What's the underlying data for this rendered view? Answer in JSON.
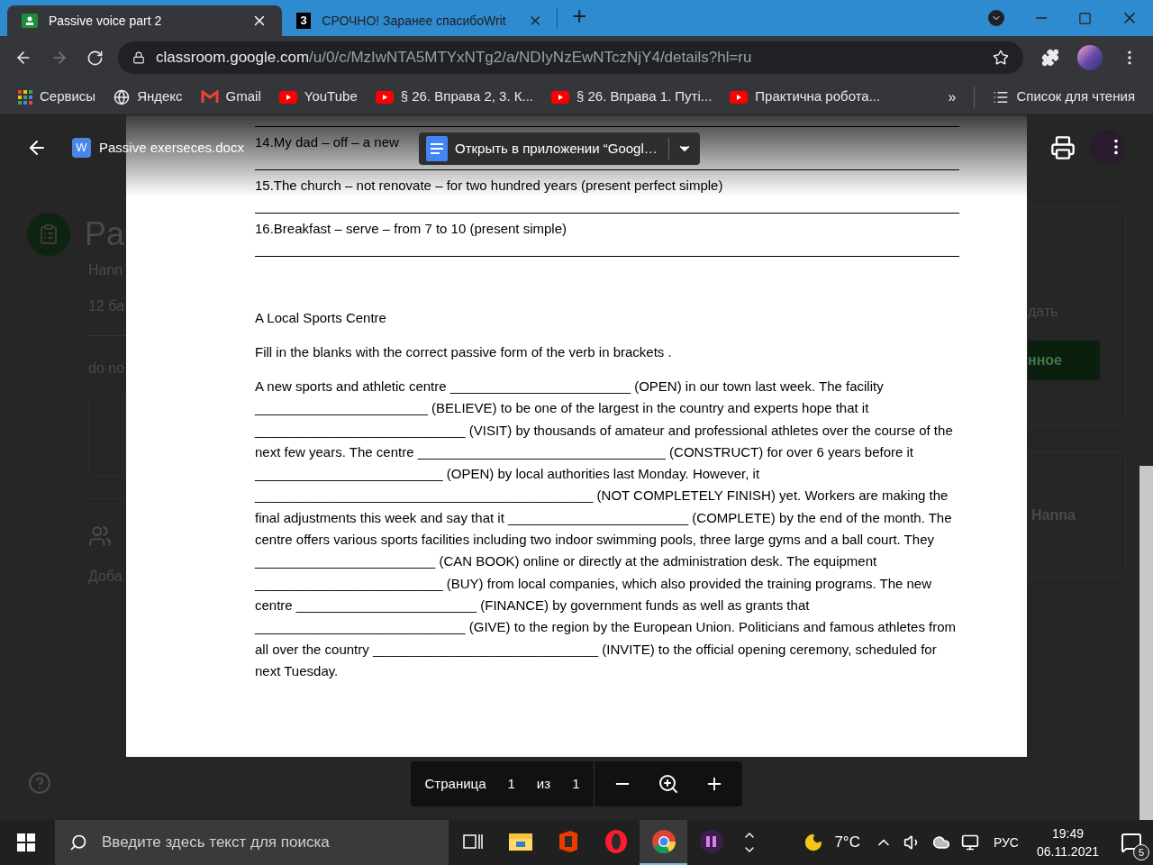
{
  "browser": {
    "tabs": [
      {
        "title": "Passive voice part 2",
        "selected": true
      },
      {
        "title": "СРОЧНО! Заранее спасибоWrit",
        "favicon_text": "3",
        "selected": false
      }
    ],
    "new_tab": "+",
    "forward_disabled": true,
    "url_host": "classroom.google.com",
    "url_path": "/u/0/c/MzIwNTA5MTYxNTg2/a/NDIyNzEwNTczNjY4/details?hl=ru",
    "bookmarks": [
      "Сервисы",
      "Яндекс",
      "Gmail",
      "YouTube",
      "§ 26. Вправа 2, 3. К...",
      "§ 26. Вправа 1. Путі...",
      "Практична робота..."
    ],
    "overflow": "»",
    "reading_list": "Список для чтения"
  },
  "background": {
    "left": {
      "title": "Pa",
      "author": "Hann",
      "points": "12 ба",
      "note": "do no",
      "add": "Доба"
    },
    "right": {
      "action": "дать",
      "button": "нное",
      "name": "Hanna"
    }
  },
  "viewer": {
    "file_name": "Passive exerseces.docx",
    "file_badge": "W",
    "open_in_app": "Открыть в приложении “Googl…"
  },
  "document": {
    "exercises": [
      "14.My dad – off – a new",
      "15.The church – not renovate – for two hundred years (present perfect simple)",
      "16.Breakfast – serve – from 7 to 10 (present simple)"
    ],
    "title": "A Local Sports Centre",
    "instruction": "Fill in the blanks with the correct passive form of the verb in brackets .",
    "passage": "A new sports and athletic centre ________________________ (OPEN) in our town last week. The facility _______________________ (BELIEVE) to be one of the largest in the country and experts hope that it ____________________________ (VISIT) by thousands of amateur and professional athletes over the course of the next few years. The centre _________________________________ (CONSTRUCT) for over 6 years before it _________________________ (OPEN) by local authorities last Monday. However, it _____________________________________________ (NOT COMPLETELY FINISH) yet. Workers are making the final adjustments this week and say that it ________________________ (COMPLETE) by the end of the month. The centre offers various sports facilities including two indoor swimming pools, three large gyms and a ball court. They ________________________ (CAN BOOK) online or directly at the administration desk. The equipment _________________________ (BUY) from local companies, which also provided the training programs. The new centre ________________________ (FINANCE) by government funds as well as grants that ____________________________ (GIVE) to the region by the European Union. Politicians and famous athletes from all over the country ______________________________ (INVITE) to the official opening ceremony, scheduled for next Tuesday."
  },
  "page_controls": {
    "label": "Страница",
    "current": "1",
    "of": "из",
    "total": "1"
  },
  "taskbar": {
    "search_placeholder": "Введите здесь текст для поиска",
    "apps": [
      {
        "active": false
      },
      {
        "active": false
      },
      {
        "active": false
      },
      {
        "active": false
      },
      {
        "active": true
      },
      {
        "active": false
      }
    ],
    "weather": "7°C",
    "language": "РУС",
    "time": "19:49",
    "date": "06.11.2021",
    "notifications": "5"
  }
}
